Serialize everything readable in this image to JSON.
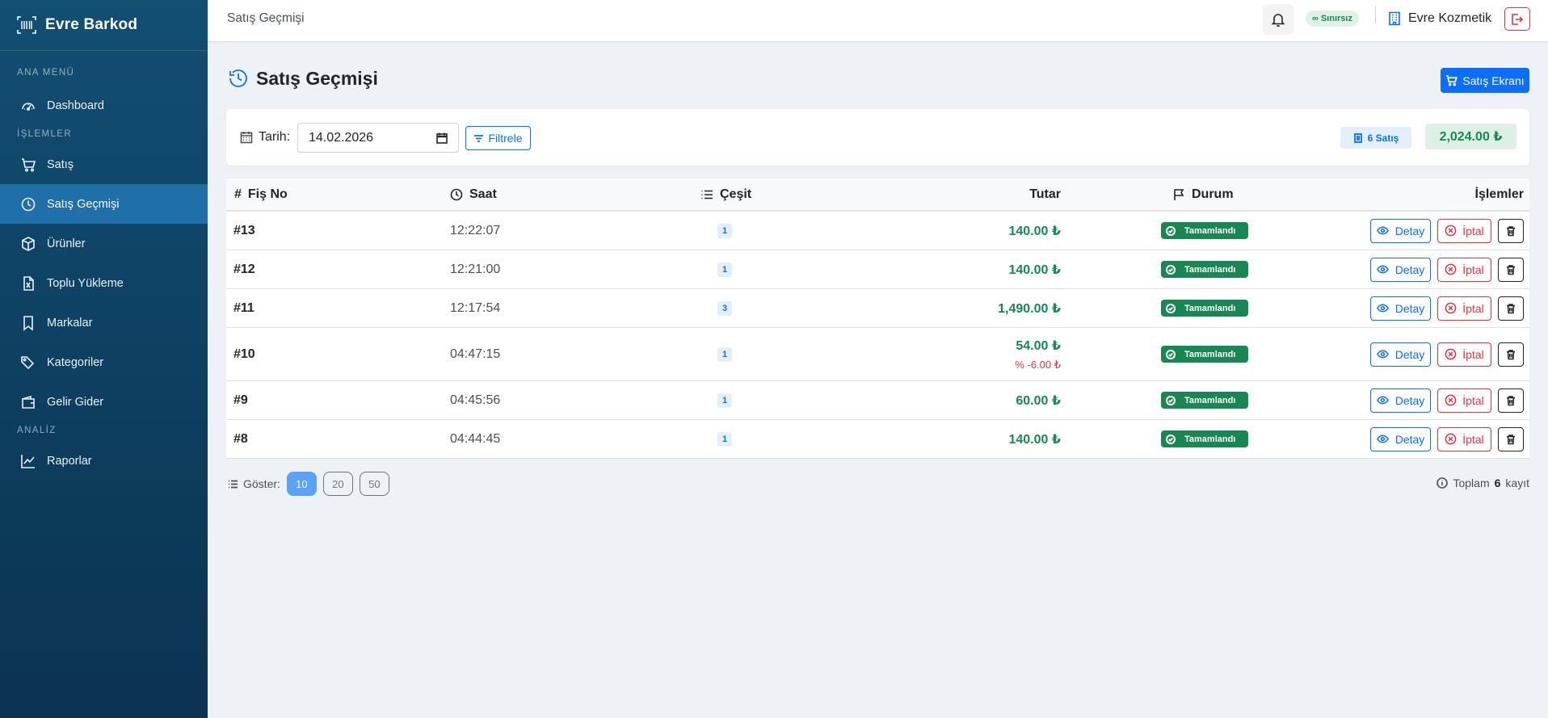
{
  "app": {
    "brand": "Evre Barkod"
  },
  "sidebar": {
    "sections": {
      "main": "ANA MENÜ",
      "ops": "İŞLEMLER",
      "analysis": "ANALİZ"
    },
    "items": {
      "dashboard": "Dashboard",
      "satis": "Satış",
      "satis_gecmisi": "Satış Geçmişi",
      "urunler": "Ürünler",
      "toplu_yukleme": "Toplu Yükleme",
      "markalar": "Markalar",
      "kategoriler": "Kategoriler",
      "gelir_gider": "Gelir Gider",
      "raporlar": "Raporlar"
    },
    "active": "satis_gecmisi"
  },
  "topbar": {
    "breadcrumb": "Satış Geçmişi",
    "limit_badge": "Sınırsız",
    "company": "Evre Kozmetik"
  },
  "page": {
    "title": "Satış Geçmişi",
    "sales_button": "Satış Ekranı"
  },
  "filter": {
    "date_label": "Tarih:",
    "date_value": "14.02.2026",
    "filter_button": "Filtrele",
    "count_badge": "6 Satış",
    "total_badge": "2,024.00 ₺"
  },
  "table": {
    "headers": {
      "hash": "#",
      "fis_no": "Fiş No",
      "saat": "Saat",
      "cesit": "Çeşit",
      "tutar": "Tutar",
      "durum": "Durum",
      "islemler": "İşlemler"
    },
    "rows": [
      {
        "fis": "#13",
        "saat": "12:22:07",
        "cesit": "1",
        "tutar": "140.00 ₺",
        "durum": "Tamamlandı"
      },
      {
        "fis": "#12",
        "saat": "12:21:00",
        "cesit": "1",
        "tutar": "140.00 ₺",
        "durum": "Tamamlandı"
      },
      {
        "fis": "#11",
        "saat": "12:17:54",
        "cesit": "3",
        "tutar": "1,490.00 ₺",
        "durum": "Tamamlandı"
      },
      {
        "fis": "#10",
        "saat": "04:47:15",
        "cesit": "1",
        "tutar": "54.00 ₺",
        "discount": "-6.00 ₺",
        "durum": "Tamamlandı"
      },
      {
        "fis": "#9",
        "saat": "04:45:56",
        "cesit": "1",
        "tutar": "60.00 ₺",
        "durum": "Tamamlandı"
      },
      {
        "fis": "#8",
        "saat": "04:44:45",
        "cesit": "1",
        "tutar": "140.00 ₺",
        "durum": "Tamamlandı"
      }
    ],
    "actions": {
      "detay": "Detay",
      "iptal": "İptal"
    }
  },
  "pagination": {
    "label": "Göster:",
    "sizes": [
      "10",
      "20",
      "50"
    ],
    "active": "10",
    "total_prefix": "Toplam",
    "total_count": "6",
    "total_suffix": "kayıt"
  },
  "colors": {
    "sidebar": "#124f73",
    "sidebar_active": "#1f6fa8",
    "primary": "#0d6efd",
    "success": "#198754",
    "danger": "#dc3545"
  }
}
